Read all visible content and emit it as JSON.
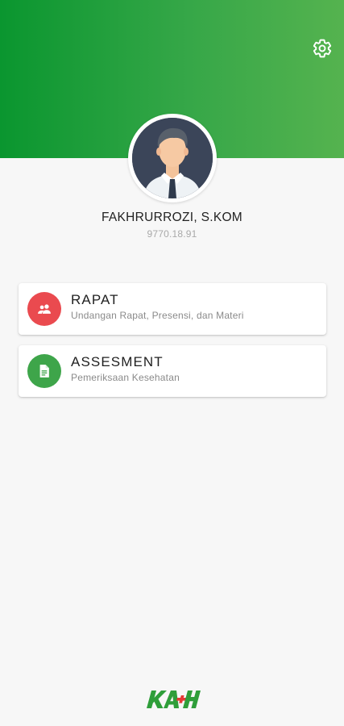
{
  "header": {
    "settings_icon": "gear-icon",
    "gradient": [
      "#0a962f",
      "#55b34f"
    ]
  },
  "profile": {
    "name": "FAKHRURROZI, S.KOM",
    "id": "9770.18.91"
  },
  "menu": [
    {
      "title": "RAPAT",
      "subtitle": "Undangan Rapat, Presensi, dan Materi",
      "icon": "people-icon",
      "icon_color": "#ea4a4f"
    },
    {
      "title": "ASSESMENT",
      "subtitle": "Pemeriksaan Kesehatan",
      "icon": "document-icon",
      "icon_color": "#3ea54a"
    }
  ],
  "footer": {
    "logo_text": "KAH",
    "logo_colors": [
      "#2f9e3a",
      "#e53935"
    ]
  }
}
